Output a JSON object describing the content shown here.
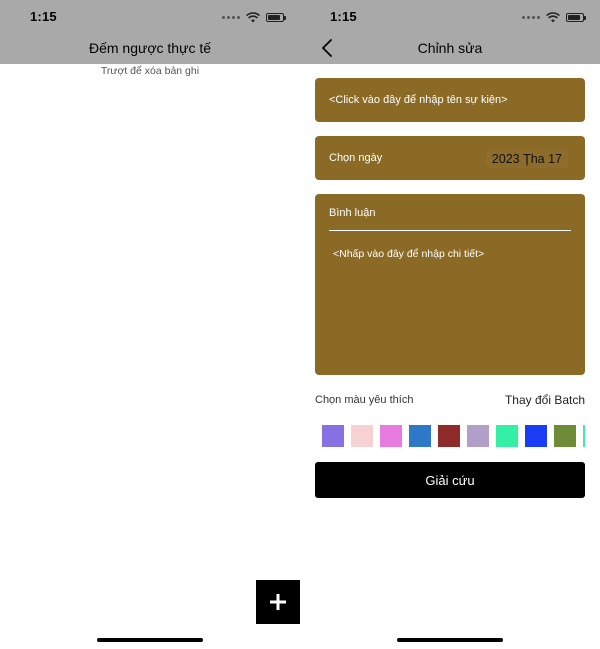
{
  "status": {
    "time": "1:15"
  },
  "list_screen": {
    "title": "Đếm ngược thực tế",
    "subtitle": "Trượt để xóa bản ghi",
    "add_icon": "plus-icon"
  },
  "edit_screen": {
    "title": "Chỉnh sửa",
    "back_icon": "chevron-left-icon",
    "event_placeholder": "<Click vào đây để nhập tên sự kiện>",
    "date_label": "Chọn ngày",
    "date_value": "2023 Ţha 17",
    "comment_label": "Bình luận",
    "comment_placeholder": "<Nhấp vào đây để nhập chi tiết>",
    "color_label": "Chọn màu yêu thích",
    "batch_label": "Thay đổi Batch",
    "swatches": [
      "#8671e2",
      "#f7d2d2",
      "#e87bdf",
      "#2d78c7",
      "#8f2b2b",
      "#b19fc9",
      "#35f0a4",
      "#1a3cf5",
      "#6d8c35",
      "#35f0a4"
    ],
    "save_label": "Giải cứu"
  },
  "colors": {
    "topbar": "#a9a9a9",
    "card": "#8b6a25",
    "button": "#000000"
  }
}
